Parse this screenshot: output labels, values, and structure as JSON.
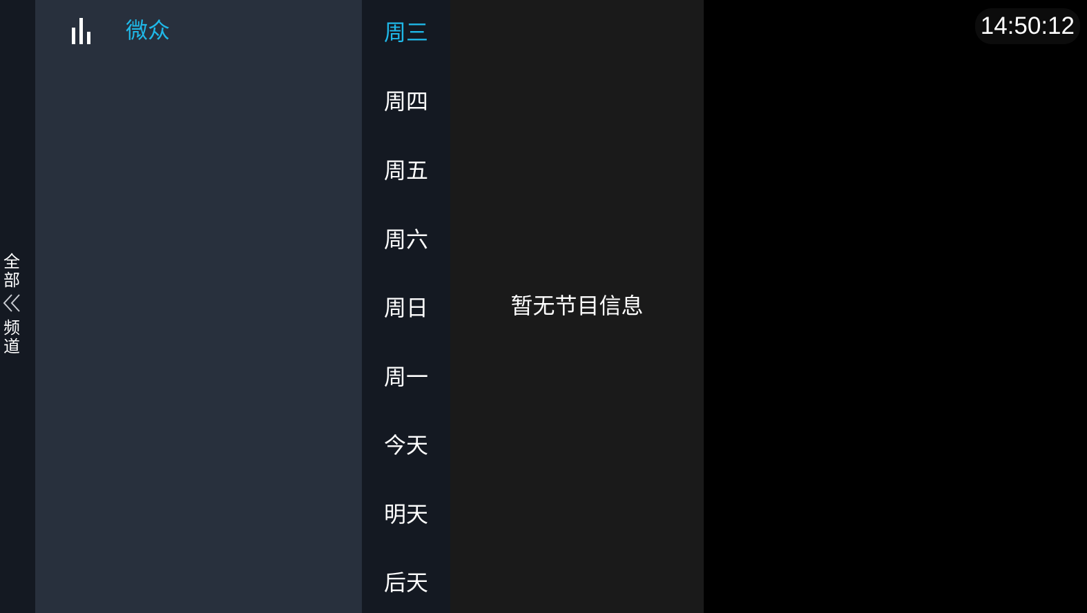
{
  "side_tab": {
    "top_label": "全部",
    "bottom_label": "频道",
    "icon": "double-chevron-left-icon"
  },
  "channels": [
    {
      "name": "微众",
      "icon": "signal-bars-icon",
      "active": true
    }
  ],
  "days": [
    {
      "label": "周三",
      "active": true
    },
    {
      "label": "周四"
    },
    {
      "label": "周五"
    },
    {
      "label": "周六"
    },
    {
      "label": "周日"
    },
    {
      "label": "周一"
    },
    {
      "label": "今天"
    },
    {
      "label": "明天"
    },
    {
      "label": "后天"
    }
  ],
  "program": {
    "empty_message": "暂无节目信息"
  },
  "clock": {
    "time": "14:50:12"
  },
  "colors": {
    "accent": "#1fb8e8",
    "channel_panel_bg": "#28303d",
    "day_panel_bg": "#141922",
    "program_panel_bg": "#1a1a1a",
    "background": "#000000"
  }
}
